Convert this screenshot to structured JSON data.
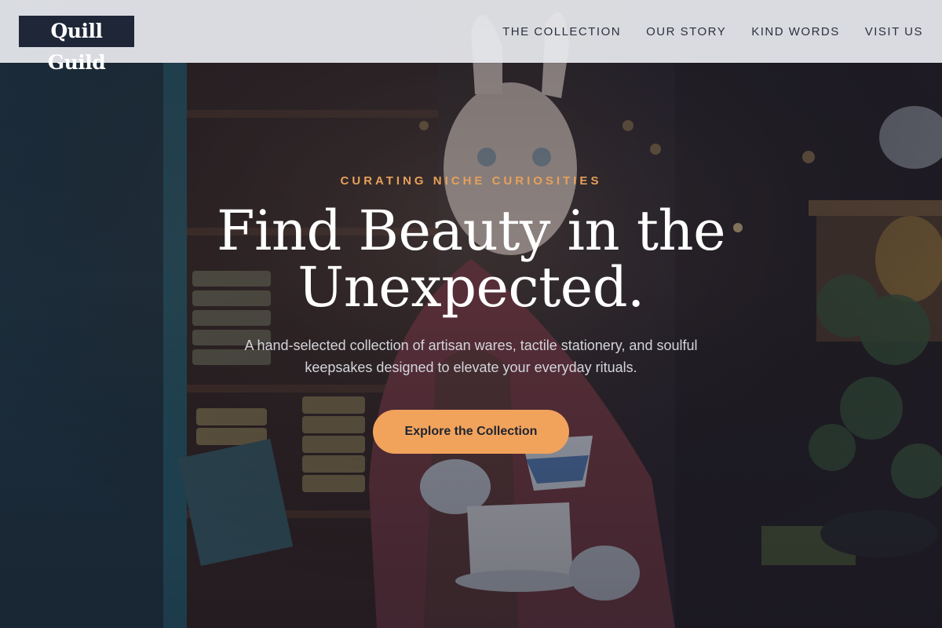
{
  "header": {
    "logo_text": "Quill Guild",
    "nav": [
      {
        "label": "THE COLLECTION"
      },
      {
        "label": "OUR STORY"
      },
      {
        "label": "KIND WORDS"
      },
      {
        "label": "VISIT US"
      }
    ]
  },
  "hero": {
    "eyebrow": "CURATING NICHE CURIOSITIES",
    "headline_line1": "Find Beauty in the",
    "headline_line2": "Unexpected.",
    "subtitle": "A hand-selected collection of artisan wares, tactile stationery, and soulful keepsakes designed to elevate your everyday rituals.",
    "cta_label": "Explore the Collection",
    "background_image": "curio-shop-rabbit-figure-photo"
  },
  "colors": {
    "accent": "#f1a35c",
    "eyebrow": "#e7a05a",
    "logo_bg": "#1e2638",
    "header_bg": "#e8eaee",
    "nav_text": "#2b3140"
  }
}
